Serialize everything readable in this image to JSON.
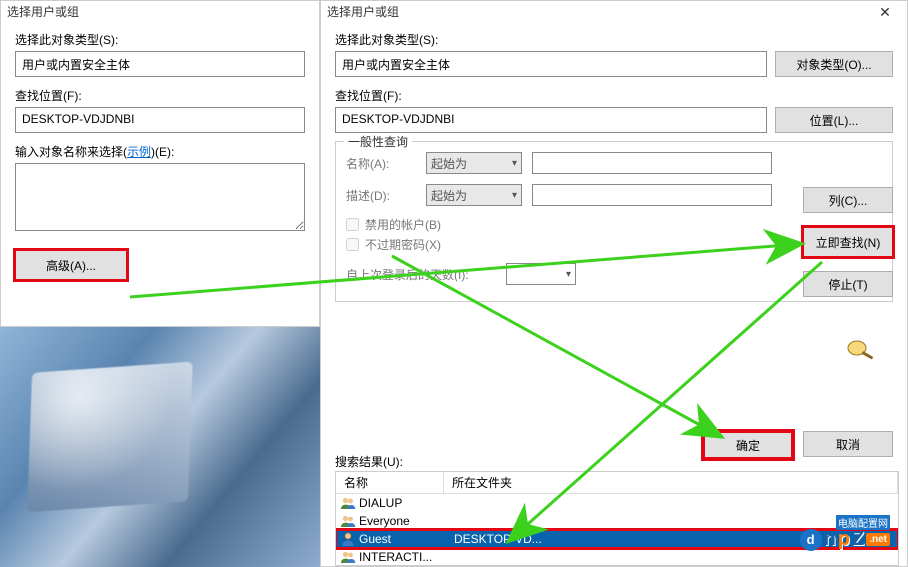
{
  "left": {
    "title": "选择用户或组",
    "object_type_label": "选择此对象类型(S):",
    "object_type_value": "用户或内置安全主体",
    "location_label": "查找位置(F):",
    "location_value": "DESKTOP-VDJDNBI",
    "names_label_prefix": "输入对象名称来选择(",
    "names_label_link": "示例",
    "names_label_suffix": ")(E):",
    "advanced_button": "高级(A)..."
  },
  "right": {
    "title": "选择用户或组",
    "object_type_label": "选择此对象类型(S):",
    "object_type_value": "用户或内置安全主体",
    "object_types_button": "对象类型(O)...",
    "location_label": "查找位置(F):",
    "location_value": "DESKTOP-VDJDNBI",
    "locations_button": "位置(L)...",
    "group_title": "一般性查询",
    "name_label": "名称(A):",
    "desc_label": "描述(D):",
    "combo_text": "起始为",
    "chk_disabled": "禁用的帐户(B)",
    "chk_noexpire": "不过期密码(X)",
    "days_label": "自上次登录后的天数(I):",
    "columns_button": "列(C)...",
    "find_now_button": "立即查找(N)",
    "stop_button": "停止(T)",
    "ok_button": "确定",
    "cancel_button": "取消",
    "results_label": "搜索结果(U):",
    "col_name": "名称",
    "col_folder": "所在文件夹",
    "results": [
      {
        "name": "DIALUP",
        "folder": "",
        "type": "group",
        "selected": false
      },
      {
        "name": "Everyone",
        "folder": "",
        "type": "group",
        "selected": false
      },
      {
        "name": "Guest",
        "folder": "DESKTOP-VD...",
        "type": "user",
        "selected": true
      },
      {
        "name": "INTERACTI...",
        "folder": "",
        "type": "group",
        "selected": false
      }
    ]
  },
  "logo": {
    "cn": "电脑配置网",
    "a": "d",
    "b": "n",
    "mid": "p",
    "z": "Z",
    "net": ".net"
  }
}
